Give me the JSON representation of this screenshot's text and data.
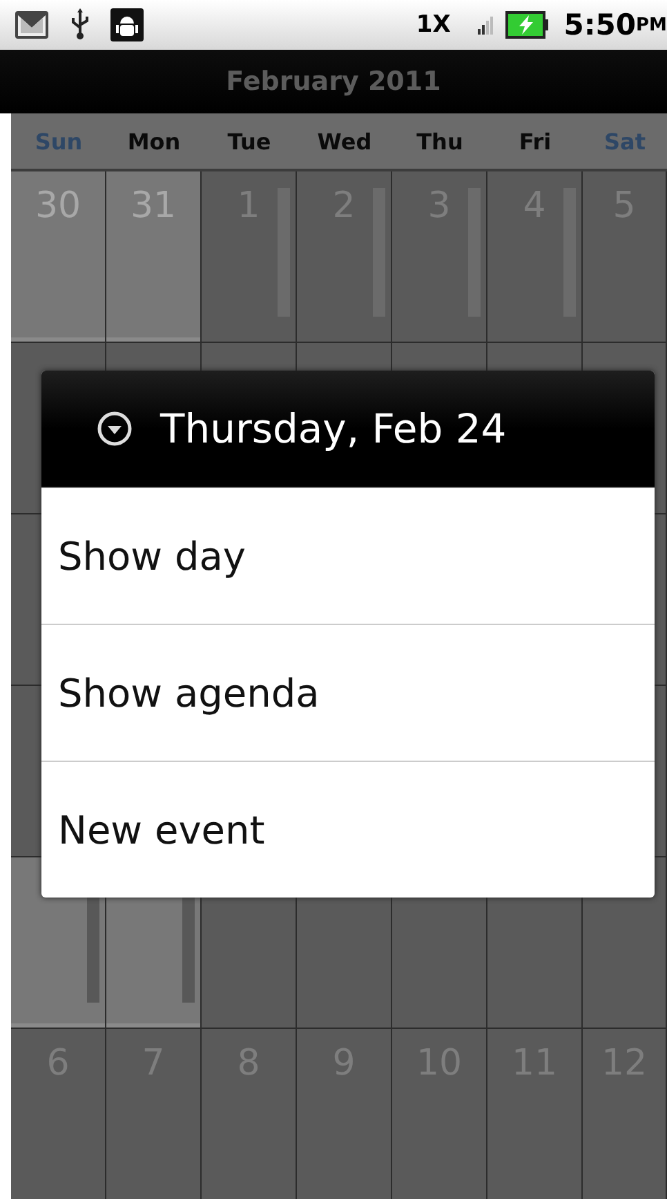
{
  "status_bar": {
    "network": "1X",
    "time": "5:50",
    "meridiem": "PM"
  },
  "title": "February 2011",
  "weekdays": [
    {
      "label": "Sun",
      "weekend": true
    },
    {
      "label": "Mon",
      "weekend": false
    },
    {
      "label": "Tue",
      "weekend": false
    },
    {
      "label": "Wed",
      "weekend": false
    },
    {
      "label": "Thu",
      "weekend": false
    },
    {
      "label": "Fri",
      "weekend": false
    },
    {
      "label": "Sat",
      "weekend": true
    }
  ],
  "weeks": [
    {
      "days": [
        {
          "label": "30",
          "highlighted": true,
          "busy": false
        },
        {
          "label": "31",
          "highlighted": true,
          "busy": false
        },
        {
          "label": "1",
          "highlighted": false,
          "busy": true
        },
        {
          "label": "2",
          "highlighted": false,
          "busy": true
        },
        {
          "label": "3",
          "highlighted": false,
          "busy": true
        },
        {
          "label": "4",
          "highlighted": false,
          "busy": true
        },
        {
          "label": "5",
          "highlighted": false,
          "busy": false
        }
      ]
    },
    {
      "covered": true
    },
    {
      "covered": true
    },
    {
      "covered": true
    },
    {
      "days": [
        {
          "highlighted": true,
          "busy": true
        },
        {
          "highlighted": true,
          "busy": true
        },
        {
          "highlighted": false,
          "busy": false
        },
        {
          "highlighted": false,
          "busy": false
        },
        {
          "highlighted": false,
          "busy": false
        },
        {
          "highlighted": false,
          "busy": false
        },
        {
          "highlighted": false,
          "busy": false
        }
      ]
    },
    {
      "days": [
        {
          "label": "6",
          "highlighted": false,
          "busy": false
        },
        {
          "label": "7",
          "highlighted": false,
          "busy": false
        },
        {
          "label": "8",
          "highlighted": false,
          "busy": false
        },
        {
          "label": "9",
          "highlighted": false,
          "busy": false
        },
        {
          "label": "10",
          "highlighted": false,
          "busy": false
        },
        {
          "label": "11",
          "highlighted": false,
          "busy": false
        },
        {
          "label": "12",
          "highlighted": false,
          "busy": false
        }
      ]
    }
  ],
  "dialog": {
    "title": "Thursday, Feb 24",
    "items": [
      "Show day",
      "Show agenda",
      "New event"
    ]
  }
}
